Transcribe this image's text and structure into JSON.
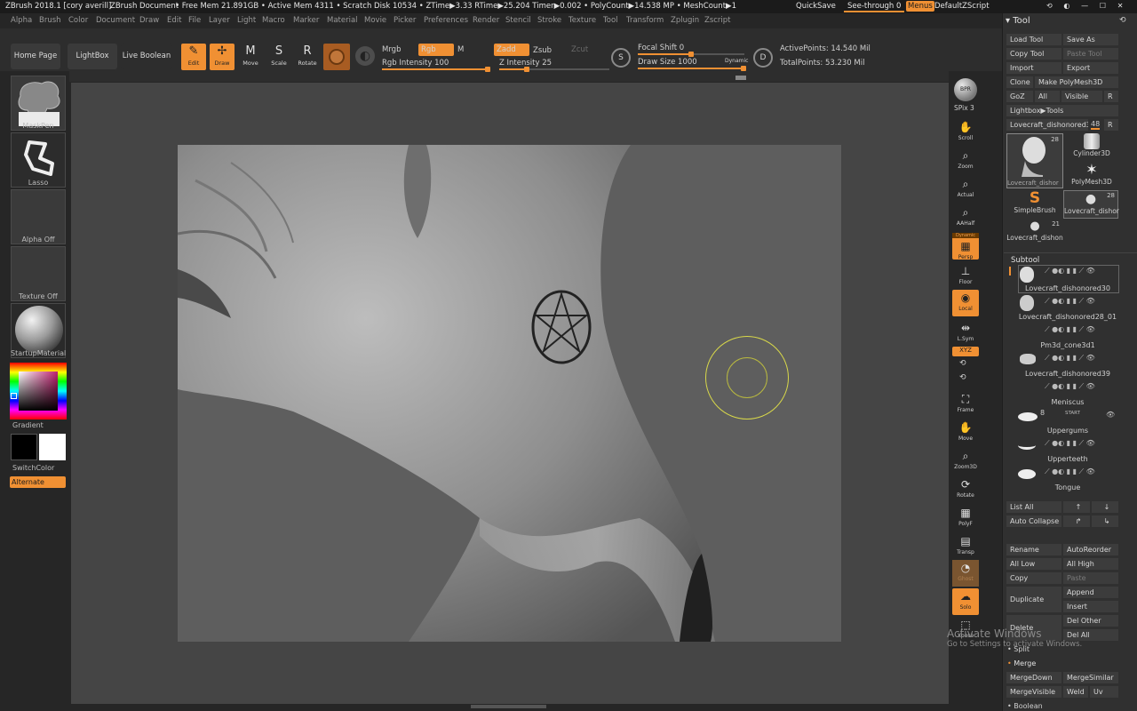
{
  "titlebar": {
    "app": "ZBrush 2018.1 [cory averill]",
    "doc": "ZBrush Document",
    "stats": "• Free Mem 21.891GB • Active Mem 4311 • Scratch Disk 10534 • ZTime▶3.33 RTime▶25.204 Timer▶0.002 • PolyCount▶14.538 MP • MeshCount▶1",
    "quicksave": "QuickSave",
    "seethrough": "See-through  0",
    "menus": "Menus",
    "zscript": "DefaultZScript"
  },
  "menubar": {
    "items": [
      "Alpha",
      "Brush",
      "Color",
      "Document",
      "Draw",
      "Edit",
      "File",
      "Layer",
      "Light",
      "Macro",
      "Marker",
      "Material",
      "Movie",
      "Picker",
      "Preferences",
      "Render",
      "Stencil",
      "Stroke",
      "Texture",
      "Tool",
      "Transform",
      "Zplugin",
      "Zscript"
    ]
  },
  "toolbar": {
    "home": "Home Page",
    "lightbox": "LightBox",
    "liveboolean": "Live Boolean",
    "edit": "Edit",
    "draw": "Draw",
    "move": "Move",
    "scale": "Scale",
    "rotate": "Rotate",
    "mrgb": "Mrgb",
    "rgb": "Rgb",
    "m": "M",
    "zadd": "Zadd",
    "zsub": "Zsub",
    "zcut": "Zcut",
    "rgbint": "Rgb Intensity 100",
    "zint": "Z Intensity 25",
    "focal": "Focal Shift 0",
    "drawsize": "Draw Size 1000",
    "dynamic": "Dynamic",
    "activepts": "ActivePoints: 14.540 Mil",
    "totalpts": "TotalPoints: 53.230 Mil",
    "rgbint_value": 1.0,
    "zint_value": 0.25,
    "focal_value": 0.5,
    "drawsize_value": 1.0
  },
  "leftshelf": {
    "brush": "MaskPen",
    "stroke": "Lasso",
    "alpha": "Alpha Off",
    "texture": "Texture Off",
    "material": "StartupMaterial",
    "gradient": "Gradient",
    "switchcolor": "SwitchColor",
    "alternate": "Alternate"
  },
  "rightshelf": {
    "bpr": "BPR",
    "spix": "SPix 3",
    "items": [
      "Scroll",
      "Zoom",
      "Actual",
      "AAHalf",
      "Persp",
      "Floor",
      "Local",
      "L.Sym",
      "Frame",
      "Move",
      "Zoom3D",
      "Rotate",
      "PolyF",
      "Transp",
      "Ghost",
      "Solo",
      "Xpose"
    ],
    "dynamic": "Dynamic",
    "xyz": "XYZ"
  },
  "toolpanel": {
    "title": "Tool",
    "loadtool": "Load Tool",
    "saveas": "Save As",
    "copytool": "Copy Tool",
    "pastetool": "Paste Tool",
    "import": "Import",
    "export": "Export",
    "clone": "Clone",
    "makepoly": "Make PolyMesh3D",
    "goz": "GoZ",
    "all": "All",
    "visible": "Visible",
    "r": "R",
    "lightboxtools": "Lightbox▶Tools",
    "current": "Lovecraft_dishonored30.",
    "current_count": "48",
    "tools": [
      {
        "name": "Lovecraft_dishor",
        "count": "28"
      },
      {
        "name": "Cylinder3D",
        "count": ""
      },
      {
        "name": "PolyMesh3D",
        "count": ""
      },
      {
        "name": "SimpleBrush",
        "count": ""
      },
      {
        "name": "Lovecraft_dishor",
        "count": "28"
      },
      {
        "name": "Lovecraft_dishon",
        "count": "21"
      }
    ],
    "subtool": "Subtool",
    "subtools": [
      "Lovecraft_dishonored30",
      "Lovecraft_dishonored28_01",
      "Pm3d_cone3d1",
      "Lovecraft_dishonored39",
      "Meniscus",
      "Uppergums",
      "Upperteeth",
      "Tongue"
    ],
    "subtool_count": "8",
    "start": "START",
    "listall": "List All",
    "autocollapse": "Auto Collapse",
    "rename": "Rename",
    "autoreorder": "AutoReorder",
    "alllow": "All Low",
    "allhigh": "All High",
    "copy": "Copy",
    "paste": "Paste",
    "duplicate": "Duplicate",
    "append": "Append",
    "insert": "Insert",
    "delother": "Del Other",
    "delete": "Delete",
    "delall": "Del All",
    "split": "Split",
    "merge": "Merge",
    "mergedown": "MergeDown",
    "mergesimilar": "MergeSimilar",
    "mergevisible": "MergeVisible",
    "weld": "Weld",
    "uv": "Uv",
    "boolean": "Boolean"
  },
  "watermark": {
    "title": "Activate Windows",
    "sub": "Go to Settings to activate Windows."
  },
  "colors": {
    "accent": "#f09033"
  }
}
